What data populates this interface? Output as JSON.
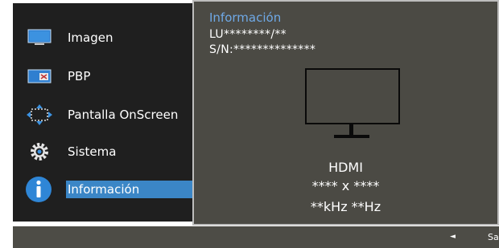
{
  "menu": {
    "items": [
      {
        "label": "Imagen",
        "icon": "monitor-icon"
      },
      {
        "label": "PBP",
        "icon": "pbp-icon"
      },
      {
        "label": "Pantalla OnScreen",
        "icon": "onscreen-display-icon"
      },
      {
        "label": "Sistema",
        "icon": "gear-icon"
      },
      {
        "label": "Información",
        "icon": "info-icon"
      }
    ],
    "selected_index": 4
  },
  "info_panel": {
    "title": "Información",
    "model": "LU********/**",
    "serial": "S/N:**************",
    "source": "HDMI",
    "resolution": "**** x ****",
    "frequency": "**kHz **Hz"
  },
  "bottom_bar": {
    "arrow": "◄",
    "exit_label": "Salir"
  },
  "colors": {
    "menu_bg": "#1f1f1f",
    "panel_bg": "#4b4a44",
    "highlight": "#3b86c6",
    "title_text": "#6fa9e6"
  }
}
